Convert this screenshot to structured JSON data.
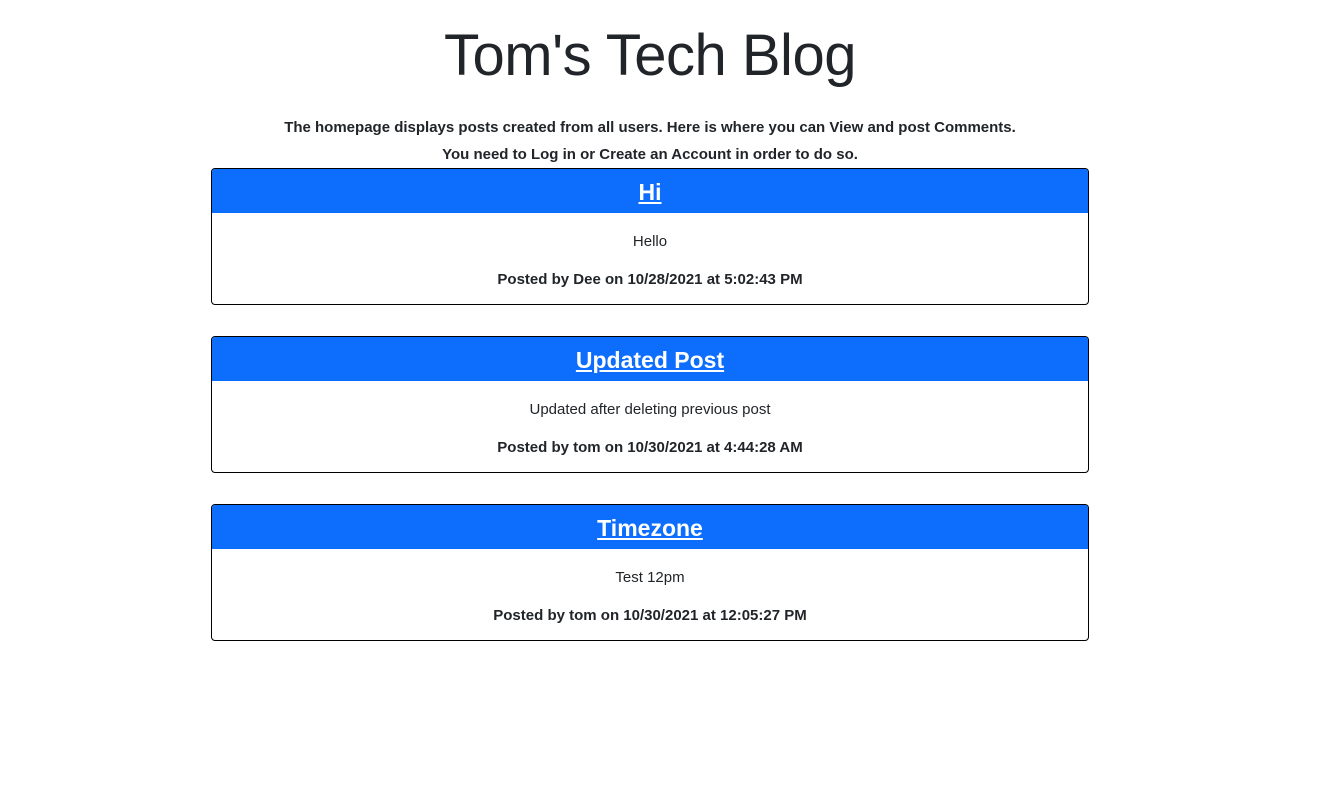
{
  "header": {
    "title": "Tom's Tech Blog"
  },
  "intro": {
    "line1": "The homepage displays posts created from all users. Here is where you can View and post Comments.",
    "line2": "You need to Log in or Create an Account in order to do so."
  },
  "posts": [
    {
      "title": "Hi",
      "content": "Hello",
      "meta": "Posted by Dee on 10/28/2021 at 5:02:43 PM"
    },
    {
      "title": "Updated Post",
      "content": "Updated after deleting previous post",
      "meta": "Posted by tom on 10/30/2021 at 4:44:28 AM"
    },
    {
      "title": "Timezone",
      "content": "Test 12pm",
      "meta": "Posted by tom on 10/30/2021 at 12:05:27 PM"
    }
  ],
  "colors": {
    "accent": "#0d6efd"
  }
}
